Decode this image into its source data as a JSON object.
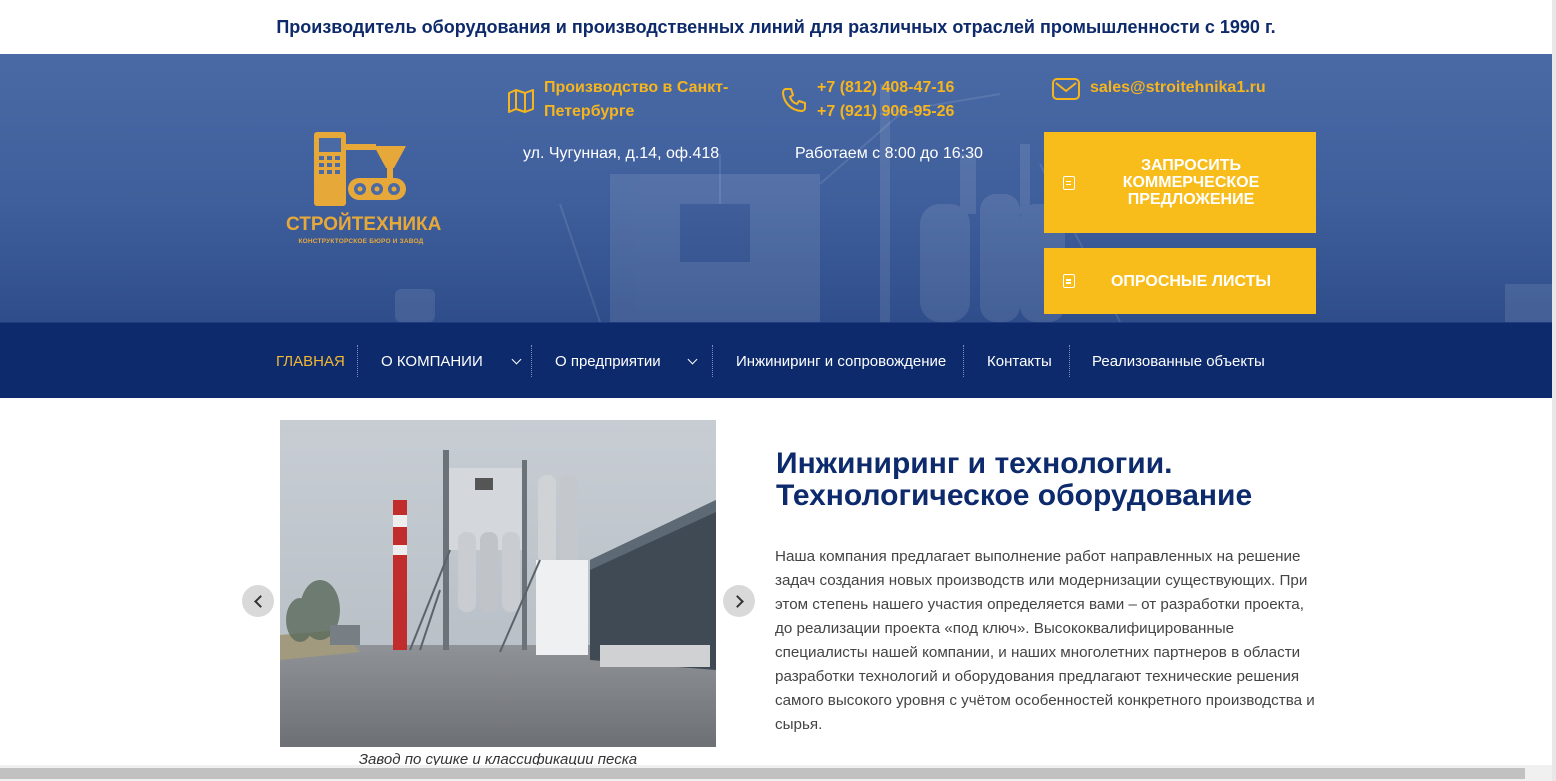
{
  "topbar": {
    "tagline": "Производитель оборудования и производственных линий для различных отраслей промышленности с 1990 г."
  },
  "logo": {
    "name": "СТРОЙТЕХНИКА",
    "subtitle": "КОНСТРУКТОРСКОЕ БЮРО И ЗАВОД",
    "icon": "factory-machine-icon"
  },
  "contacts": {
    "location": {
      "icon": "map-icon",
      "line1": "Производство в Санкт-",
      "line2": "Петербурге",
      "address": "ул. Чугунная, д.14, оф.418"
    },
    "phone": {
      "icon": "phone-icon",
      "phone1": "+7 (812) 408-47-16",
      "phone2": "+7 (921) 906-95-26",
      "hours": "Работаем с 8:00 до 16:30"
    },
    "email": {
      "icon": "envelope-icon",
      "address": "sales@stroitehnika1.ru"
    }
  },
  "cta": {
    "request_line1": "ЗАПРОСИТЬ",
    "request_line2": "КОММЕРЧЕСКОЕ",
    "request_line3": "ПРЕДЛОЖЕНИЕ",
    "questionnaire": "ОПРОСНЫЕ ЛИСТЫ",
    "icon": "document-icon"
  },
  "nav": {
    "items": [
      {
        "label": "ГЛАВНАЯ",
        "active": true
      },
      {
        "label": "О КОМПАНИИ",
        "dropdown": true
      },
      {
        "label": "О предприятии",
        "dropdown": true
      },
      {
        "label": "Инжиниринг и сопровождение"
      },
      {
        "label": "Контакты"
      },
      {
        "label": "Реализованные объекты"
      }
    ]
  },
  "slider": {
    "caption": "Завод по сушке и классификации песка"
  },
  "content": {
    "title_line1": "Инжиниринг и технологии.",
    "title_line2": "Технологическое оборудование",
    "paragraph": "Наша компания предлагает выполнение работ направленных на решение задач создания новых производств или модернизации существующих. При этом степень нашего участия определяется вами – от разработки проекта, до реализации проекта «под ключ». Высококвалифицированные специалисты нашей компании, и наших многолетних партнеров в области разработки технологий и оборудования предлагают технические решения самого высокого уровня с учётом особенностей конкретного производства и сырья."
  },
  "colors": {
    "brand_navy": "#0c2a6c",
    "accent_yellow": "#f8bd1b",
    "hero_blue": "#3f5f9c"
  }
}
